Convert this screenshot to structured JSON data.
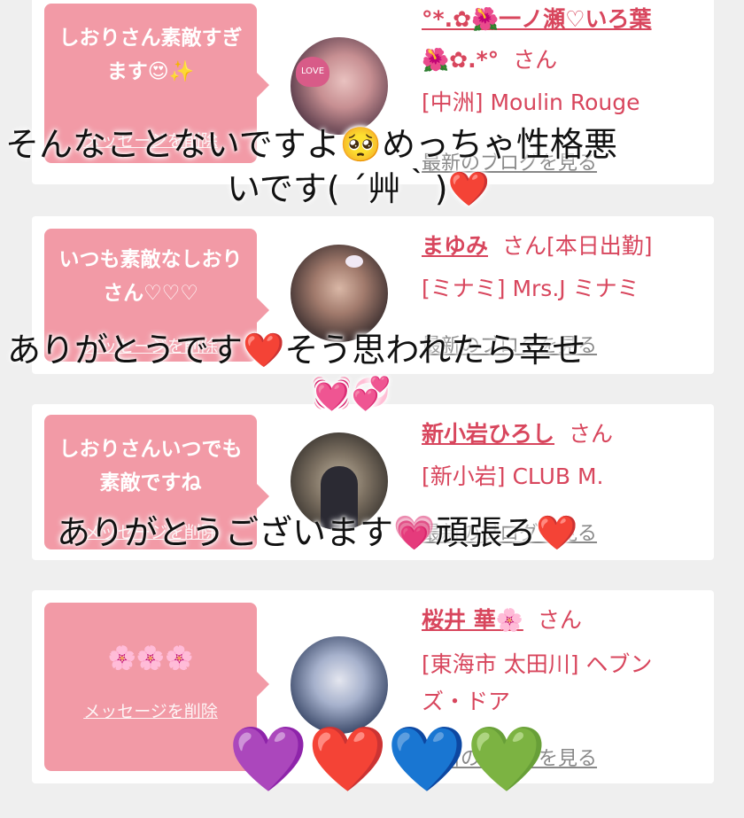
{
  "cards": [
    {
      "bubble_text": "しおりさん素敵すぎます😍✨",
      "delete_label": "メッセージを削除",
      "name_line1": "°*.✿🌺一ノ瀬♡いろ葉",
      "name_line2": "🌺✿.*°",
      "san": "さん",
      "shop": "[中洲] Moulin Rouge",
      "blog": "最新のブログを見る"
    },
    {
      "bubble_text": "いつも素敵なしおりさん♡♡♡",
      "delete_label": "メッセージを削除",
      "name": "まゆみ",
      "san": "さん[本日出勤]",
      "shop": "[ミナミ] Mrs.J ミナミ",
      "blog": "最新のブログを見る"
    },
    {
      "bubble_text": "しおりさんいつでも素敵ですね",
      "delete_label": "メッセージを削除",
      "name": "新小岩ひろし",
      "san": "さん",
      "shop": "[新小岩] CLUB M.",
      "blog": "最新のブログを見る"
    },
    {
      "bubble_text": "🌸🌸🌸",
      "delete_label": "メッセージを削除",
      "name": "桜井 華🌸",
      "san": "さん",
      "shop_line1": "[東海市 太田川] ヘブン",
      "shop_line2": "ズ・ドア",
      "blog": "最新のブログを見る"
    }
  ],
  "overlay": {
    "line1": "そんなことないですよ🥺めっちゃ性格悪",
    "line2": "いです( ´艸｀)❤️",
    "line3": "ありがとうです❤️そう思われたら幸せ",
    "line4": "💓💞",
    "line5": "ありがとうございます💗頑張ろ❤️",
    "hearts": "💜❤️💙💚"
  },
  "colors": {
    "bubble": "#f29aa6",
    "link": "#d8465d",
    "background": "#efefef"
  }
}
